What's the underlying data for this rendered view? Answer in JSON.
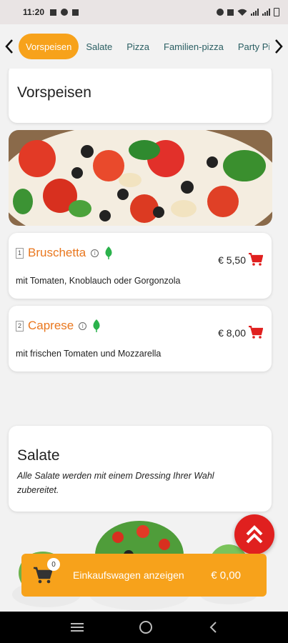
{
  "status": {
    "time": "11:20"
  },
  "tabs": [
    {
      "label": "Vorspeisen",
      "active": true
    },
    {
      "label": "Salate",
      "active": false
    },
    {
      "label": "Pizza",
      "active": false
    },
    {
      "label": "Familien-pizza",
      "active": false
    },
    {
      "label": "Party Pi",
      "active": false
    }
  ],
  "sections": {
    "vorspeisen": {
      "title": "Vorspeisen",
      "items": [
        {
          "number": "1",
          "name": "Bruschetta",
          "price": "€ 5,50",
          "description": "mit Tomaten, Knoblauch oder Gorgonzola"
        },
        {
          "number": "2",
          "name": "Caprese",
          "price": "€ 8,00",
          "description": "mit frischen Tomaten und Mozzarella"
        }
      ]
    },
    "salate": {
      "title": "Salate",
      "description": "Alle Salate werden mit einem Dressing Ihrer Wahl zubereitet."
    }
  },
  "cart": {
    "count": "0",
    "label": "Einkaufswagen anzeigen",
    "total": "€ 0,00"
  },
  "colors": {
    "accent": "#f7a21b",
    "item_name": "#e9771e",
    "cart_red": "#e0201f",
    "veg_green": "#2bb24c",
    "tab_text": "#2b5f63"
  },
  "icons": [
    "chevron-left-icon",
    "chevron-right-icon",
    "info-icon",
    "vegetarian-leaf-icon",
    "cart-add-icon",
    "double-chevron-up-icon",
    "cart-icon",
    "menu-icon",
    "home-icon",
    "back-icon"
  ]
}
